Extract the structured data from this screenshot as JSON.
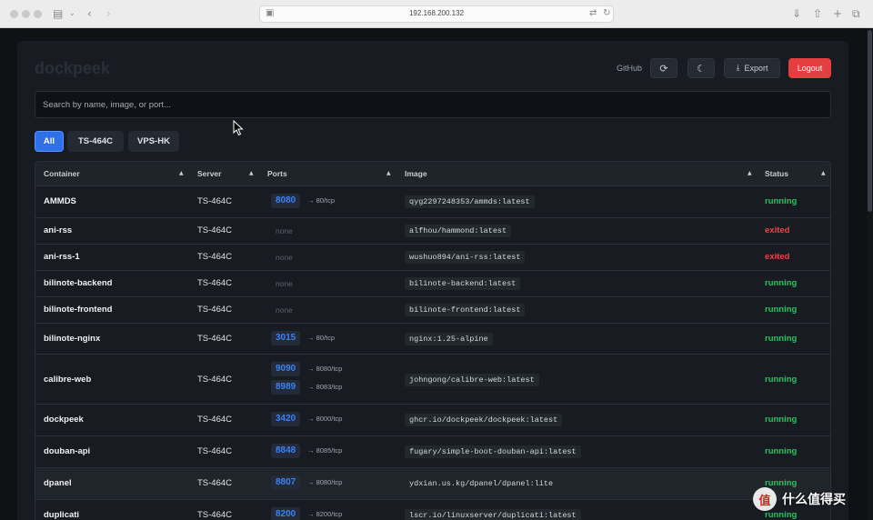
{
  "browser": {
    "url": "192.168.200.132",
    "icons": [
      "sidebar-toggle-icon",
      "chevron-down-icon",
      "back-icon",
      "forward-icon",
      "page-icon",
      "translate-icon",
      "reload-icon",
      "download-icon",
      "share-icon",
      "new-tab-icon",
      "tab-overview-icon"
    ]
  },
  "app": {
    "brand": "dockpeek",
    "github_label": "GitHub",
    "export_label": "Export",
    "logout_label": "Logout",
    "search_placeholder": "Search by name, image, or port...",
    "filters": [
      {
        "label": "All",
        "active": true
      },
      {
        "label": "TS-464C",
        "active": false
      },
      {
        "label": "VPS-HK",
        "active": false
      }
    ],
    "colors": {
      "accent": "#2f6fe8",
      "logout": "#e53e3e",
      "running": "#22c55e",
      "exited": "#ef4444",
      "port": "#3b82f6"
    }
  },
  "table": {
    "headers": [
      "Container",
      "Server",
      "Ports",
      "Image",
      "Status"
    ],
    "rows": [
      {
        "name": "AMMDS",
        "server": "TS-464C",
        "ports": [
          {
            "port": "8080",
            "map": "→ 80/tcp"
          }
        ],
        "image": "qyg2297248353/ammds:latest",
        "status": "running"
      },
      {
        "name": "ani-rss",
        "server": "TS-464C",
        "ports": [],
        "ports_none": "none",
        "image": "alfhou/hammond:latest",
        "status": "exited"
      },
      {
        "name": "ani-rss-1",
        "server": "TS-464C",
        "ports": [],
        "ports_none": "none",
        "image": "wushuo894/ani-rss:latest",
        "status": "exited"
      },
      {
        "name": "bilinote-backend",
        "server": "TS-464C",
        "ports": [],
        "ports_none": "none",
        "image": "bilinote-backend:latest",
        "status": "running"
      },
      {
        "name": "bilinote-frontend",
        "server": "TS-464C",
        "ports": [],
        "ports_none": "none",
        "image": "bilinote-frontend:latest",
        "status": "running"
      },
      {
        "name": "bilinote-nginx",
        "server": "TS-464C",
        "ports": [
          {
            "port": "3015",
            "map": "→ 80/tcp"
          }
        ],
        "image": "nginx:1.25-alpine",
        "status": "running"
      },
      {
        "name": "calibre-web",
        "server": "TS-464C",
        "ports": [
          {
            "port": "9090",
            "map": "→ 8080/tcp"
          },
          {
            "port": "8989",
            "map": "→ 8083/tcp"
          }
        ],
        "image": "johngong/calibre-web:latest",
        "status": "running"
      },
      {
        "name": "dockpeek",
        "server": "TS-464C",
        "ports": [
          {
            "port": "3420",
            "map": "→ 8000/tcp"
          }
        ],
        "image": "ghcr.io/dockpeek/dockpeek:latest",
        "status": "running"
      },
      {
        "name": "douban-api",
        "server": "TS-464C",
        "ports": [
          {
            "port": "8848",
            "map": "→ 8085/tcp"
          }
        ],
        "image": "fugary/simple-boot-douban-api:latest",
        "status": "running"
      },
      {
        "name": "dpanel",
        "server": "TS-464C",
        "ports": [
          {
            "port": "8807",
            "map": "→ 8080/tcp"
          }
        ],
        "image": "ydxian.us.kg/dpanel/dpanel:lite",
        "status": "running"
      },
      {
        "name": "duplicati",
        "server": "TS-464C",
        "ports": [
          {
            "port": "8200",
            "map": "→ 8200/tcp"
          }
        ],
        "image": "lscr.io/linuxserver/duplicati:latest",
        "status": "running"
      }
    ]
  },
  "watermark": {
    "badge": "值",
    "text": "什么值得买"
  }
}
